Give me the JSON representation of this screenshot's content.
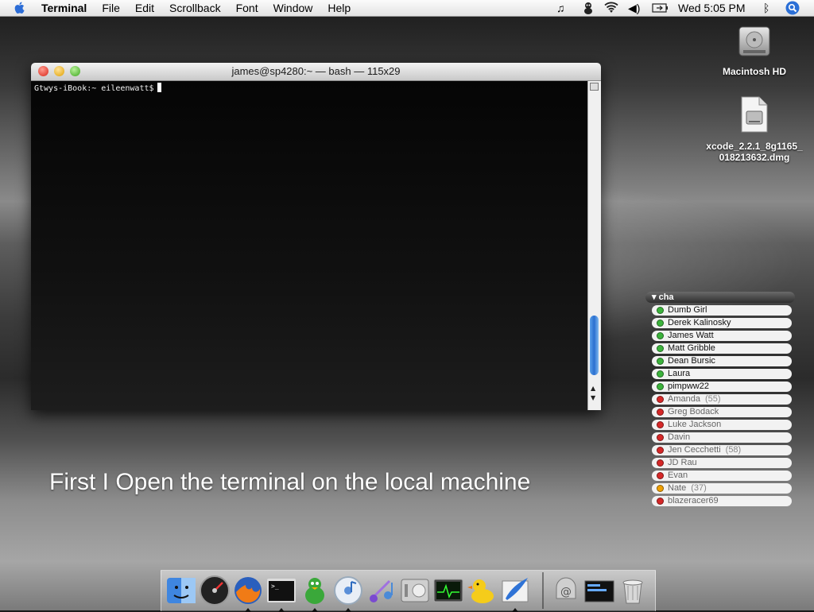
{
  "menubar": {
    "apple_icon": "apple-icon",
    "app_name": "Terminal",
    "menus": [
      "File",
      "Edit",
      "Scrollback",
      "Font",
      "Window",
      "Help"
    ],
    "clock": "Wed 5:05 PM",
    "status_icons": [
      "music-note-icon",
      "adium-duck-icon",
      "wifi-icon",
      "volume-icon",
      "battery-icon",
      "bluetooth-icon",
      "spotlight-icon"
    ]
  },
  "desktop": {
    "icons": [
      {
        "label": "Macintosh HD",
        "icon": "hard-drive-icon"
      },
      {
        "label_line1": "xcode_2.2.1_8g1165_",
        "label_line2": "018213632.dmg",
        "icon": "dmg-file-icon"
      }
    ]
  },
  "terminal": {
    "title": "james@sp4280:~ — bash — 115x29",
    "prompt": "Gtwys-iBook:~ eileenwatt$"
  },
  "caption": "First I Open the terminal on the local machine",
  "buddy_list": {
    "group": "cha",
    "buddies": [
      {
        "name": "Dumb Girl",
        "status": "available",
        "idle": ""
      },
      {
        "name": "Derek Kalinosky",
        "status": "available",
        "idle": ""
      },
      {
        "name": "James Watt",
        "status": "available",
        "idle": ""
      },
      {
        "name": "Matt Gribble",
        "status": "available",
        "idle": ""
      },
      {
        "name": "Dean Bursic",
        "status": "available",
        "idle": ""
      },
      {
        "name": "Laura",
        "status": "available",
        "idle": ""
      },
      {
        "name": "pimpww22",
        "status": "available",
        "idle": ""
      },
      {
        "name": "Amanda",
        "status": "away",
        "idle": "(55)"
      },
      {
        "name": "Greg Bodack",
        "status": "away",
        "idle": ""
      },
      {
        "name": "Luke Jackson",
        "status": "away",
        "idle": ""
      },
      {
        "name": "Davin",
        "status": "away",
        "idle": ""
      },
      {
        "name": "Jen Cecchetti",
        "status": "away",
        "idle": "(58)"
      },
      {
        "name": "JD Rau",
        "status": "away",
        "idle": ""
      },
      {
        "name": "Evan",
        "status": "away",
        "idle": ""
      },
      {
        "name": "Nate",
        "status": "idle",
        "idle": "(37)"
      },
      {
        "name": "blazeracer69",
        "status": "away",
        "idle": ""
      }
    ],
    "status_colors": {
      "available": "#3cb33c",
      "away": "#d62828",
      "idle": "#f0a000"
    }
  },
  "dock": {
    "apps": [
      "finder-icon",
      "dashboard-icon",
      "firefox-icon",
      "terminal-icon",
      "adium-icon",
      "itunes-icon",
      "itunes-alt-icon",
      "system-preferences-icon",
      "activity-monitor-icon",
      "cyberduck-icon",
      "mail-feather-icon"
    ],
    "others": [
      "mail-stack-icon",
      "exposé-window-icon",
      "trash-icon"
    ]
  }
}
